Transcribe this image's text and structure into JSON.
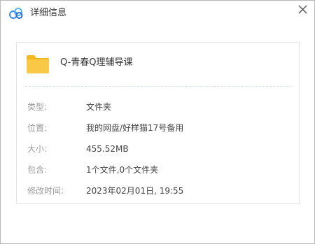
{
  "window": {
    "title": "详细信息"
  },
  "file": {
    "name": "Q-青春Q理辅导课",
    "icon": "folder-icon"
  },
  "details": [
    {
      "label": "类型:",
      "value": "文件夹"
    },
    {
      "label": "位置:",
      "value": "我的网盘/好样猫17号备用"
    },
    {
      "label": "大小:",
      "value": "455.52MB"
    },
    {
      "label": "包含:",
      "value": "1个文件,0个文件夹"
    },
    {
      "label": "修改时间:",
      "value": "2023年02月01日, 19:55"
    }
  ],
  "colors": {
    "accent_blue": "#4a90e2",
    "folder_yellow": "#f9c845",
    "folder_tab": "#f3b81f",
    "label_gray": "#9b9b9b"
  },
  "icons": {
    "app": "cloud-drive-icon",
    "close": "close-icon"
  }
}
